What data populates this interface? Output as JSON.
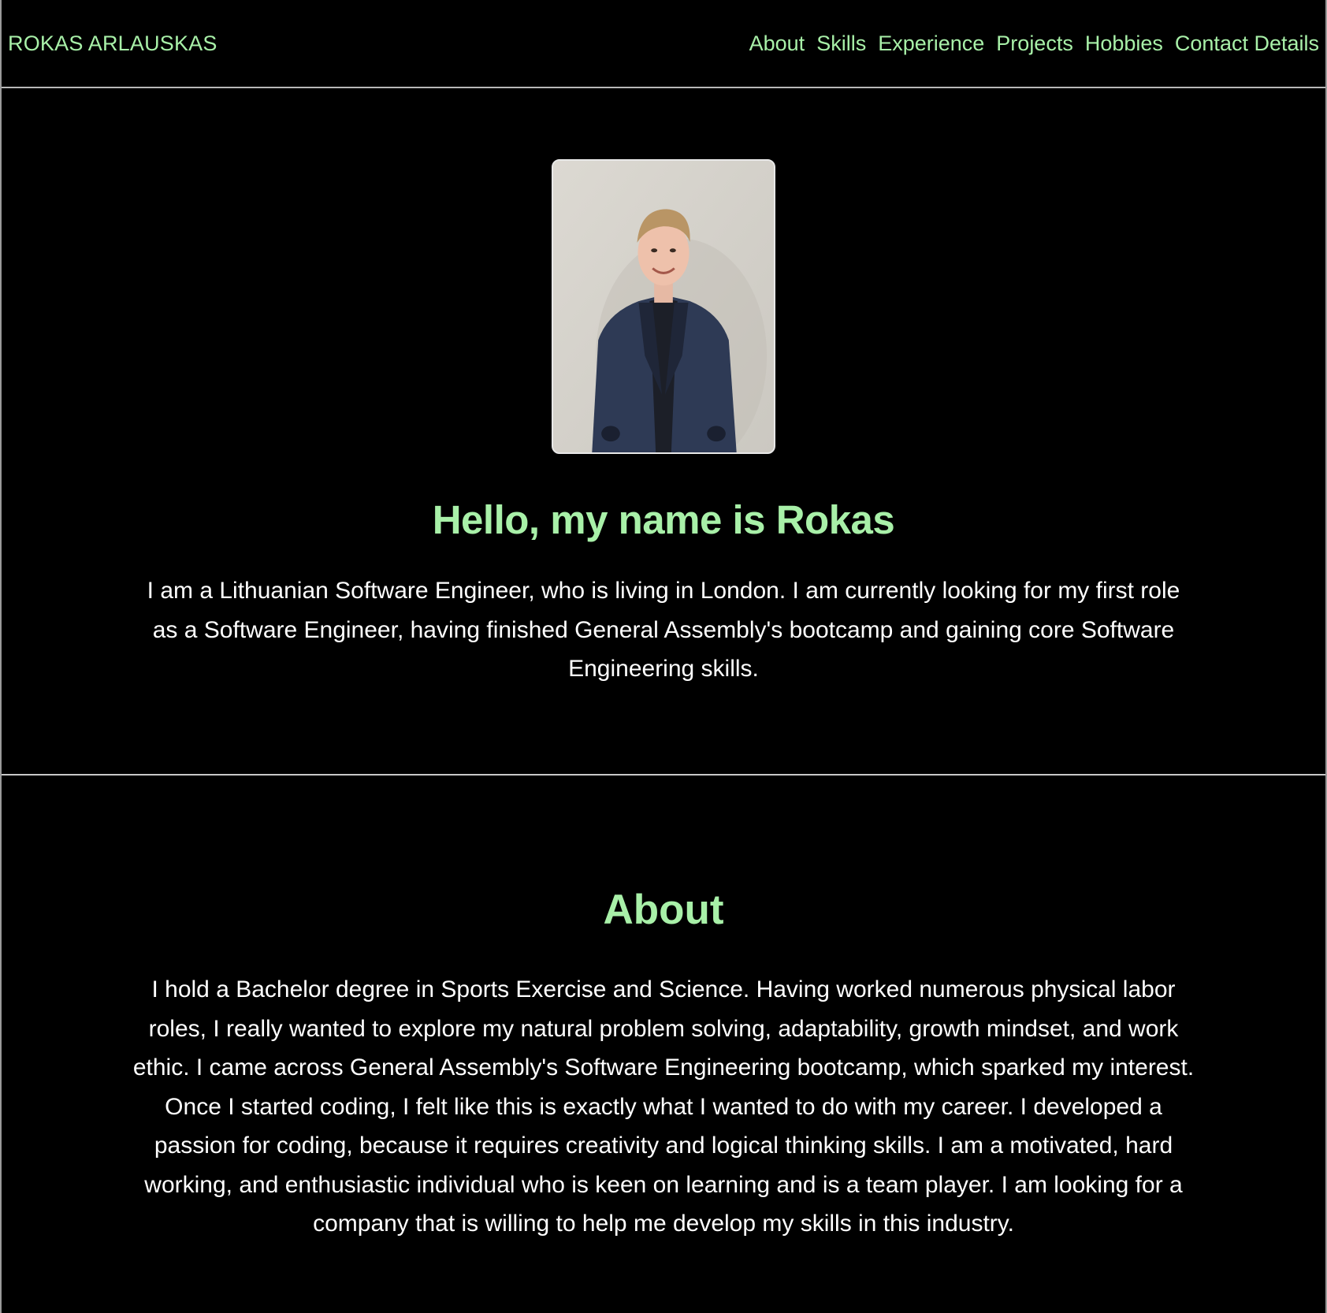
{
  "theme": {
    "accent": "#a8f0a8",
    "text": "#ffffff",
    "background": "#000000"
  },
  "navbar": {
    "brand": "ROKAS ARLAUSKAS",
    "links": [
      {
        "label": "About"
      },
      {
        "label": "Skills"
      },
      {
        "label": "Experience"
      },
      {
        "label": "Projects"
      },
      {
        "label": "Hobbies"
      },
      {
        "label": "Contact Details"
      }
    ]
  },
  "hero": {
    "portrait_icon": "profile-photo",
    "title": "Hello, my name is Rokas",
    "text": "I am a Lithuanian Software Engineer, who is living in London. I am currently looking for my first role as a Software Engineer, having finished General Assembly's bootcamp and gaining core Software Engineering skills."
  },
  "about": {
    "title": "About",
    "text": "I hold a Bachelor degree in Sports Exercise and Science. Having worked numerous physical labor roles, I really wanted to explore my natural problem solving, adaptability, growth mindset, and work ethic. I came across General Assembly's Software Engineering bootcamp, which sparked my interest. Once I started coding, I felt like this is exactly what I wanted to do with my career. I developed a passion for coding, because it requires creativity and logical thinking skills. I am a motivated, hard working, and enthusiastic individual who is keen on learning and is a team player. I am looking for a company that is willing to help me develop my skills in this industry."
  }
}
